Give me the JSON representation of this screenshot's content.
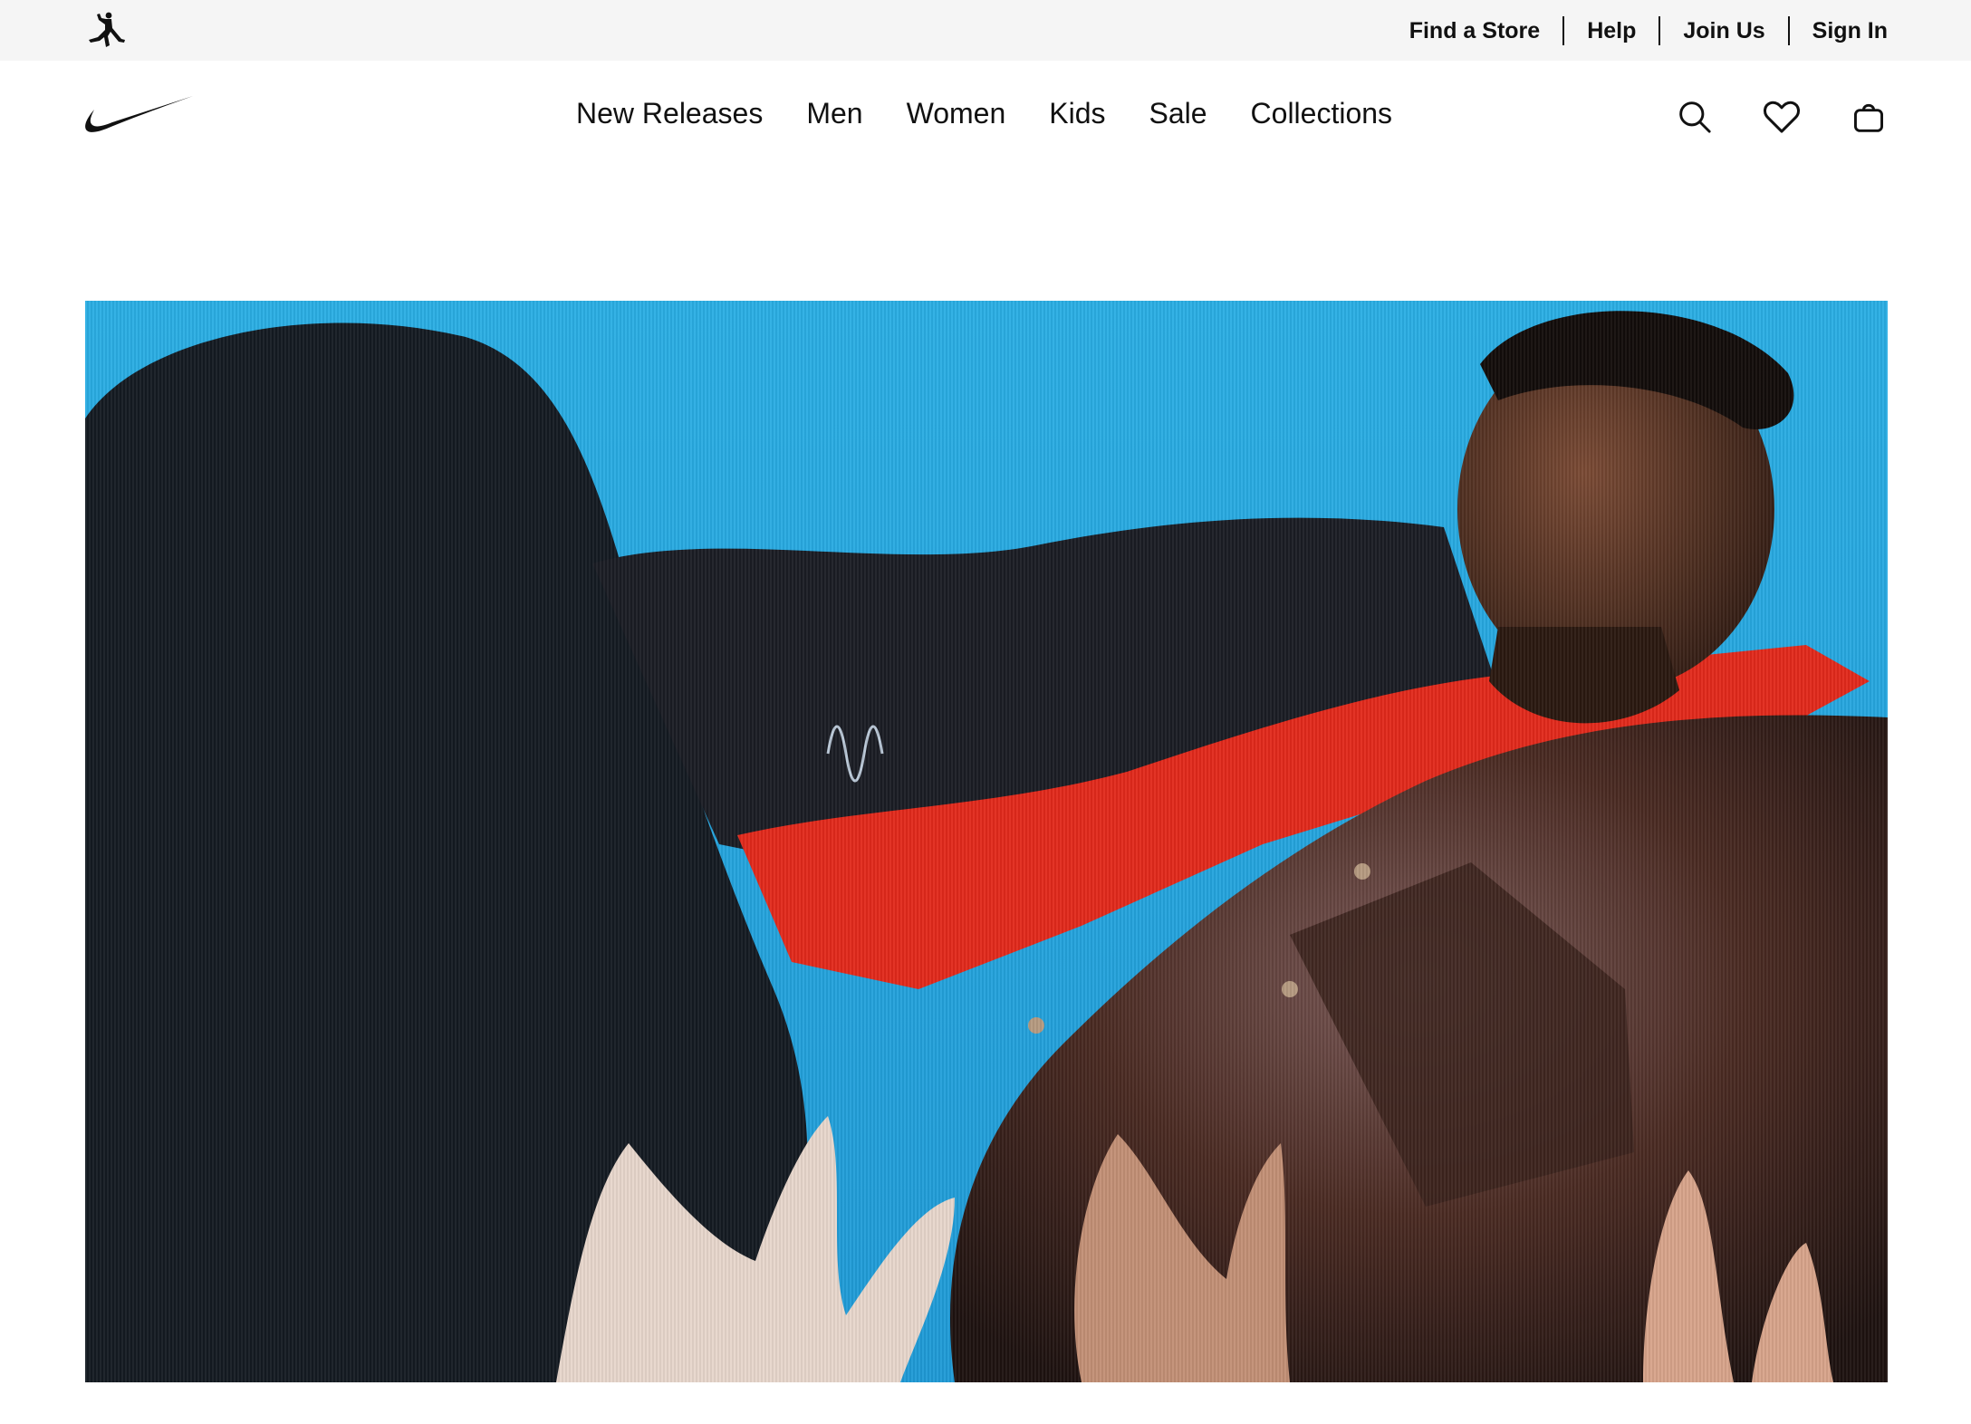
{
  "utility_bar": {
    "brand_icon": "jordan-jumpman-icon",
    "links": [
      "Find a Store",
      "Help",
      "Join Us",
      "Sign In"
    ]
  },
  "header": {
    "brand_icon": "nike-swoosh-icon",
    "nav": [
      "New Releases",
      "Men",
      "Women",
      "Kids",
      "Sale",
      "Collections"
    ],
    "icons": [
      "search-icon",
      "heart-icon",
      "bag-icon"
    ]
  },
  "hero": {
    "image": "campaign-photo",
    "colors": {
      "sky": "#27a9e0",
      "garment_dark": "#141a22",
      "accent_red": "#e2291b",
      "leather": "#4a2a22"
    }
  },
  "colors": {
    "utility_bg": "#f5f5f5",
    "text": "#111111",
    "page_bg": "#ffffff"
  }
}
